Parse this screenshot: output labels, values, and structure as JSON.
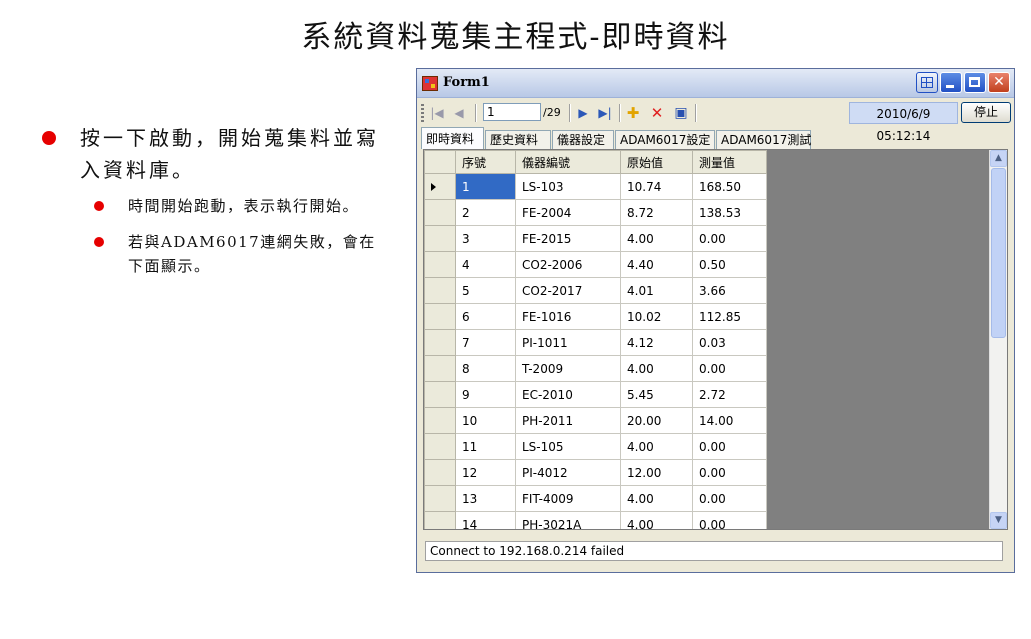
{
  "slide": {
    "title": "系統資料蒐集主程式-即時資料",
    "bullets": [
      {
        "text": "按一下啟動，開始蒐集料並寫入資料庫。",
        "sub": [
          "時間開始跑動，表示執行開始。",
          "若與ADAM6017連網失敗，會在下面顯示。"
        ]
      }
    ]
  },
  "window": {
    "title": "Form1",
    "toolbar": {
      "position": "1",
      "count": "/29",
      "datetime": "2010/6/9 05:12:14",
      "stop_label": "停止"
    },
    "tabs": [
      "即時資料",
      "歷史資料",
      "儀器設定",
      "ADAM6017設定",
      "ADAM6017測試"
    ],
    "table": {
      "columns": [
        "序號",
        "儀器編號",
        "原始值",
        "測量值"
      ],
      "rows": [
        [
          "1",
          "LS-103",
          "10.74",
          "168.50"
        ],
        [
          "2",
          "FE-2004",
          "8.72",
          "138.53"
        ],
        [
          "3",
          "FE-2015",
          "4.00",
          "0.00"
        ],
        [
          "4",
          "CO2-2006",
          "4.40",
          "0.50"
        ],
        [
          "5",
          "CO2-2017",
          "4.01",
          "3.66"
        ],
        [
          "6",
          "FE-1016",
          "10.02",
          "112.85"
        ],
        [
          "7",
          "PI-1011",
          "4.12",
          "0.03"
        ],
        [
          "8",
          "T-2009",
          "4.00",
          "0.00"
        ],
        [
          "9",
          "EC-2010",
          "5.45",
          "2.72"
        ],
        [
          "10",
          "PH-2011",
          "20.00",
          "14.00"
        ],
        [
          "11",
          "LS-105",
          "4.00",
          "0.00"
        ],
        [
          "12",
          "PI-4012",
          "12.00",
          "0.00"
        ],
        [
          "13",
          "FIT-4009",
          "4.00",
          "0.00"
        ],
        [
          "14",
          "PH-3021A",
          "4.00",
          "0.00"
        ]
      ]
    },
    "status": "Connect to 192.168.0.214 failed"
  }
}
